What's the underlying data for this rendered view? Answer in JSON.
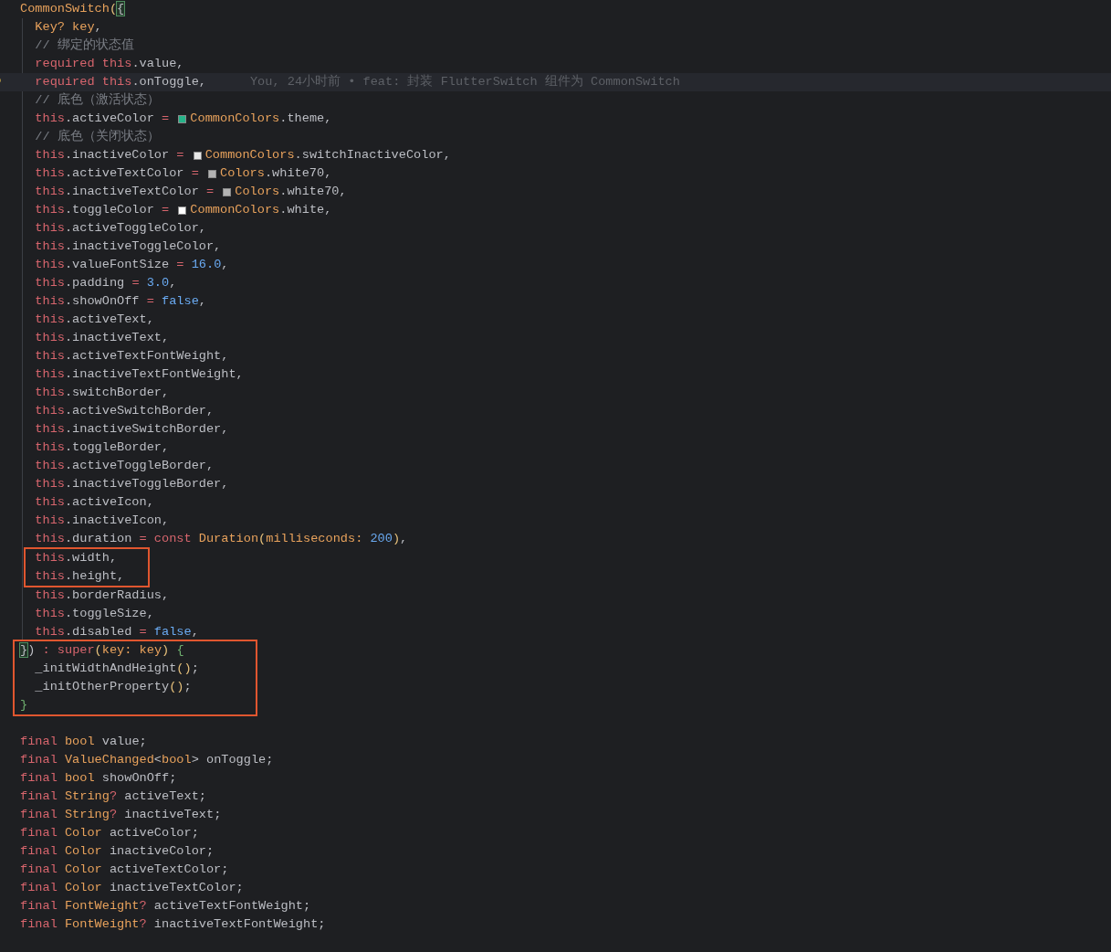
{
  "editor": {
    "blocks": [
      {
        "guide": false,
        "boxed": false,
        "blank_before": false,
        "lines": [
          {
            "tokens": [
              {
                "kind": "type",
                "text": "CommonSwitch"
              },
              {
                "kind": "paren",
                "text": "("
              },
              {
                "kind": "match",
                "text": "{"
              }
            ]
          }
        ]
      },
      {
        "guide": true,
        "boxed": false,
        "blank_before": false,
        "lines": [
          {
            "tokens": [
              {
                "kind": "type",
                "text": "  Key? key"
              },
              {
                "kind": "plain",
                "text": ","
              }
            ]
          },
          {
            "tokens": [
              {
                "kind": "comment",
                "text": "  // 绑定的状态值"
              }
            ]
          },
          {
            "tokens": [
              {
                "kind": "kw",
                "text": "  required this"
              },
              {
                "kind": "plain",
                "text": ".value,"
              }
            ]
          },
          {
            "tokens": [
              {
                "kind": "kw",
                "text": "  required this"
              },
              {
                "kind": "plain",
                "text": ".onToggle,"
              }
            ],
            "blame": "You, 24小时前 • feat: 封装 FlutterSwitch 组件为 CommonSwitch"
          },
          {
            "tokens": [
              {
                "kind": "comment",
                "text": "  // 底色（激活状态）"
              }
            ]
          },
          {
            "tokens": [
              {
                "kind": "kw",
                "text": "  this"
              },
              {
                "kind": "plain",
                "text": ".activeColor "
              },
              {
                "kind": "kw",
                "text": "= "
              },
              {
                "kind": "swatch",
                "color": "#26b389"
              },
              {
                "kind": "type",
                "text": "CommonColors"
              },
              {
                "kind": "plain",
                "text": ".theme,"
              }
            ]
          },
          {
            "tokens": [
              {
                "kind": "comment",
                "text": "  // 底色（关闭状态）"
              }
            ]
          },
          {
            "tokens": [
              {
                "kind": "kw",
                "text": "  this"
              },
              {
                "kind": "plain",
                "text": ".inactiveColor "
              },
              {
                "kind": "kw",
                "text": "= "
              },
              {
                "kind": "swatch",
                "color": "#e8e8e8"
              },
              {
                "kind": "type",
                "text": "CommonColors"
              },
              {
                "kind": "plain",
                "text": ".switchInactiveColor,"
              }
            ]
          },
          {
            "tokens": [
              {
                "kind": "kw",
                "text": "  this"
              },
              {
                "kind": "plain",
                "text": ".activeTextColor "
              },
              {
                "kind": "kw",
                "text": "= "
              },
              {
                "kind": "swatch",
                "color": "#b3b3b3"
              },
              {
                "kind": "type",
                "text": "Colors"
              },
              {
                "kind": "plain",
                "text": ".white70,"
              }
            ]
          },
          {
            "tokens": [
              {
                "kind": "kw",
                "text": "  this"
              },
              {
                "kind": "plain",
                "text": ".inactiveTextColor "
              },
              {
                "kind": "kw",
                "text": "= "
              },
              {
                "kind": "swatch",
                "color": "#b3b3b3"
              },
              {
                "kind": "type",
                "text": "Colors"
              },
              {
                "kind": "plain",
                "text": ".white70,"
              }
            ]
          },
          {
            "tokens": [
              {
                "kind": "kw",
                "text": "  this"
              },
              {
                "kind": "plain",
                "text": ".toggleColor "
              },
              {
                "kind": "kw",
                "text": "= "
              },
              {
                "kind": "swatch",
                "color": "#ffffff"
              },
              {
                "kind": "type",
                "text": "CommonColors"
              },
              {
                "kind": "plain",
                "text": ".white,"
              }
            ]
          },
          {
            "tokens": [
              {
                "kind": "kw",
                "text": "  this"
              },
              {
                "kind": "plain",
                "text": ".activeToggleColor,"
              }
            ]
          },
          {
            "tokens": [
              {
                "kind": "kw",
                "text": "  this"
              },
              {
                "kind": "plain",
                "text": ".inactiveToggleColor,"
              }
            ]
          },
          {
            "tokens": [
              {
                "kind": "kw",
                "text": "  this"
              },
              {
                "kind": "plain",
                "text": ".valueFontSize "
              },
              {
                "kind": "kw",
                "text": "= "
              },
              {
                "kind": "num",
                "text": "16.0"
              },
              {
                "kind": "plain",
                "text": ","
              }
            ]
          },
          {
            "tokens": [
              {
                "kind": "kw",
                "text": "  this"
              },
              {
                "kind": "plain",
                "text": ".padding "
              },
              {
                "kind": "kw",
                "text": "= "
              },
              {
                "kind": "num",
                "text": "3.0"
              },
              {
                "kind": "plain",
                "text": ","
              }
            ]
          },
          {
            "tokens": [
              {
                "kind": "kw",
                "text": "  this"
              },
              {
                "kind": "plain",
                "text": ".showOnOff "
              },
              {
                "kind": "kw",
                "text": "= "
              },
              {
                "kind": "num",
                "text": "false"
              },
              {
                "kind": "plain",
                "text": ","
              }
            ]
          },
          {
            "tokens": [
              {
                "kind": "kw",
                "text": "  this"
              },
              {
                "kind": "plain",
                "text": ".activeText,"
              }
            ]
          },
          {
            "tokens": [
              {
                "kind": "kw",
                "text": "  this"
              },
              {
                "kind": "plain",
                "text": ".inactiveText,"
              }
            ]
          },
          {
            "tokens": [
              {
                "kind": "kw",
                "text": "  this"
              },
              {
                "kind": "plain",
                "text": ".activeTextFontWeight,"
              }
            ]
          },
          {
            "tokens": [
              {
                "kind": "kw",
                "text": "  this"
              },
              {
                "kind": "plain",
                "text": ".inactiveTextFontWeight,"
              }
            ]
          },
          {
            "tokens": [
              {
                "kind": "kw",
                "text": "  this"
              },
              {
                "kind": "plain",
                "text": ".switchBorder,"
              }
            ]
          },
          {
            "tokens": [
              {
                "kind": "kw",
                "text": "  this"
              },
              {
                "kind": "plain",
                "text": ".activeSwitchBorder,"
              }
            ]
          },
          {
            "tokens": [
              {
                "kind": "kw",
                "text": "  this"
              },
              {
                "kind": "plain",
                "text": ".inactiveSwitchBorder,"
              }
            ]
          },
          {
            "tokens": [
              {
                "kind": "kw",
                "text": "  this"
              },
              {
                "kind": "plain",
                "text": ".toggleBorder,"
              }
            ]
          },
          {
            "tokens": [
              {
                "kind": "kw",
                "text": "  this"
              },
              {
                "kind": "plain",
                "text": ".activeToggleBorder,"
              }
            ]
          },
          {
            "tokens": [
              {
                "kind": "kw",
                "text": "  this"
              },
              {
                "kind": "plain",
                "text": ".inactiveToggleBorder,"
              }
            ]
          },
          {
            "tokens": [
              {
                "kind": "kw",
                "text": "  this"
              },
              {
                "kind": "plain",
                "text": ".activeIcon,"
              }
            ]
          },
          {
            "tokens": [
              {
                "kind": "kw",
                "text": "  this"
              },
              {
                "kind": "plain",
                "text": ".inactiveIcon,"
              }
            ]
          },
          {
            "tokens": [
              {
                "kind": "kw",
                "text": "  this"
              },
              {
                "kind": "plain",
                "text": ".duration "
              },
              {
                "kind": "kw",
                "text": "= const "
              },
              {
                "kind": "type",
                "text": "Duration"
              },
              {
                "kind": "paren",
                "text": "("
              },
              {
                "kind": "param",
                "text": "milliseconds: "
              },
              {
                "kind": "num",
                "text": "200"
              },
              {
                "kind": "paren",
                "text": ")"
              },
              {
                "kind": "plain",
                "text": ","
              }
            ]
          }
        ]
      },
      {
        "guide": true,
        "boxed": true,
        "blank_before": false,
        "lines": [
          {
            "tokens": [
              {
                "kind": "kw",
                "text": "  this"
              },
              {
                "kind": "plain",
                "text": ".width,"
              }
            ]
          },
          {
            "tokens": [
              {
                "kind": "kw",
                "text": "  this"
              },
              {
                "kind": "plain",
                "text": ".height,"
              }
            ]
          }
        ]
      },
      {
        "guide": true,
        "boxed": false,
        "blank_before": false,
        "lines": [
          {
            "tokens": [
              {
                "kind": "kw",
                "text": "  this"
              },
              {
                "kind": "plain",
                "text": ".borderRadius,"
              }
            ]
          },
          {
            "tokens": [
              {
                "kind": "kw",
                "text": "  this"
              },
              {
                "kind": "plain",
                "text": ".toggleSize,"
              }
            ]
          },
          {
            "tokens": [
              {
                "kind": "kw",
                "text": "  this"
              },
              {
                "kind": "plain",
                "text": ".disabled "
              },
              {
                "kind": "kw",
                "text": "= "
              },
              {
                "kind": "num",
                "text": "false"
              },
              {
                "kind": "plain",
                "text": ","
              }
            ]
          }
        ]
      },
      {
        "guide": false,
        "boxed": true,
        "blank_before": false,
        "lines": [
          {
            "tokens": [
              {
                "kind": "match",
                "text": "}"
              },
              {
                "kind": "plain",
                "text": ") "
              },
              {
                "kind": "kw",
                "text": ": super"
              },
              {
                "kind": "paren",
                "text": "("
              },
              {
                "kind": "param",
                "text": "key: key"
              },
              {
                "kind": "paren",
                "text": ")"
              },
              {
                "kind": "brace",
                "text": " {"
              }
            ]
          },
          {
            "tokens": [
              {
                "kind": "plain",
                "text": "  _initWidthAndHeight"
              },
              {
                "kind": "paren",
                "text": "()"
              },
              {
                "kind": "plain",
                "text": ";"
              }
            ]
          },
          {
            "tokens": [
              {
                "kind": "plain",
                "text": "  _initOtherProperty"
              },
              {
                "kind": "paren",
                "text": "()"
              },
              {
                "kind": "plain",
                "text": ";"
              }
            ]
          },
          {
            "tokens": [
              {
                "kind": "brace",
                "text": "}"
              }
            ]
          }
        ]
      },
      {
        "guide": false,
        "boxed": false,
        "blank_before": true,
        "lines": [
          {
            "tokens": [
              {
                "kind": "kw",
                "text": "final "
              },
              {
                "kind": "type",
                "text": "bool"
              },
              {
                "kind": "plain",
                "text": " value;"
              }
            ]
          },
          {
            "tokens": [
              {
                "kind": "kw",
                "text": "final "
              },
              {
                "kind": "type",
                "text": "ValueChanged"
              },
              {
                "kind": "plain",
                "text": "<"
              },
              {
                "kind": "type",
                "text": "bool"
              },
              {
                "kind": "plain",
                "text": "> onToggle;"
              }
            ]
          },
          {
            "tokens": [
              {
                "kind": "kw",
                "text": "final "
              },
              {
                "kind": "type",
                "text": "bool"
              },
              {
                "kind": "plain",
                "text": " showOnOff;"
              }
            ]
          },
          {
            "tokens": [
              {
                "kind": "kw",
                "text": "final "
              },
              {
                "kind": "type",
                "text": "String"
              },
              {
                "kind": "kw",
                "text": "?"
              },
              {
                "kind": "plain",
                "text": " activeText;"
              }
            ]
          },
          {
            "tokens": [
              {
                "kind": "kw",
                "text": "final "
              },
              {
                "kind": "type",
                "text": "String"
              },
              {
                "kind": "kw",
                "text": "?"
              },
              {
                "kind": "plain",
                "text": " inactiveText;"
              }
            ]
          },
          {
            "tokens": [
              {
                "kind": "kw",
                "text": "final "
              },
              {
                "kind": "type",
                "text": "Color"
              },
              {
                "kind": "plain",
                "text": " activeColor;"
              }
            ]
          },
          {
            "tokens": [
              {
                "kind": "kw",
                "text": "final "
              },
              {
                "kind": "type",
                "text": "Color"
              },
              {
                "kind": "plain",
                "text": " inactiveColor;"
              }
            ]
          },
          {
            "tokens": [
              {
                "kind": "kw",
                "text": "final "
              },
              {
                "kind": "type",
                "text": "Color"
              },
              {
                "kind": "plain",
                "text": " activeTextColor;"
              }
            ]
          },
          {
            "tokens": [
              {
                "kind": "kw",
                "text": "final "
              },
              {
                "kind": "type",
                "text": "Color"
              },
              {
                "kind": "plain",
                "text": " inactiveTextColor;"
              }
            ]
          },
          {
            "tokens": [
              {
                "kind": "kw",
                "text": "final "
              },
              {
                "kind": "type",
                "text": "FontWeight"
              },
              {
                "kind": "kw",
                "text": "?"
              },
              {
                "kind": "plain",
                "text": " activeTextFontWeight;"
              }
            ]
          },
          {
            "tokens": [
              {
                "kind": "kw",
                "text": "final "
              },
              {
                "kind": "type",
                "text": "FontWeight"
              },
              {
                "kind": "kw",
                "text": "?"
              },
              {
                "kind": "plain",
                "text": " inactiveTextFontWeight;"
              }
            ]
          }
        ]
      }
    ]
  }
}
